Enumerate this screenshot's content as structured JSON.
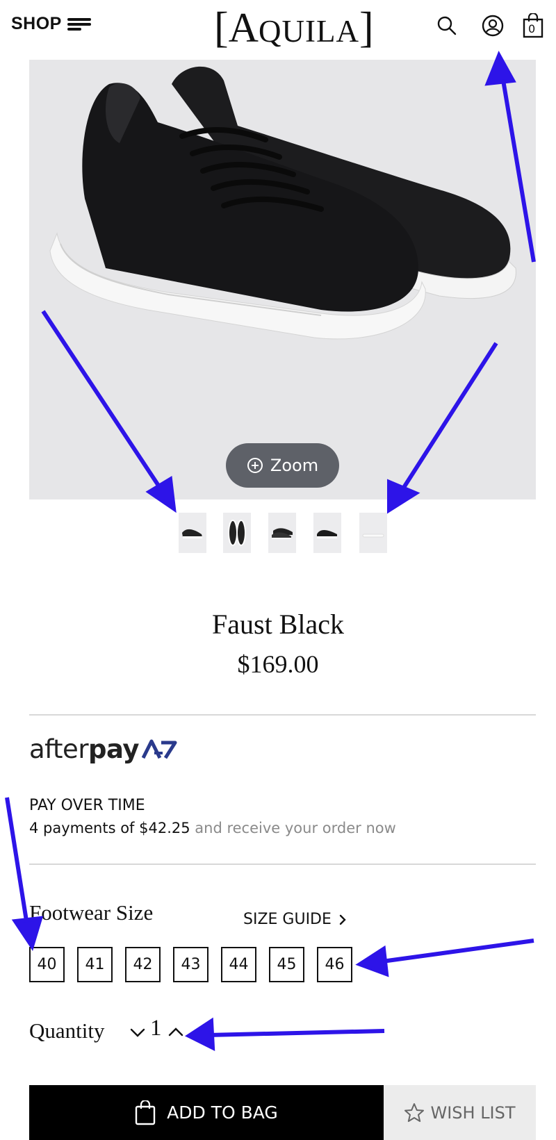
{
  "header": {
    "shop_label": "SHOP",
    "logo": {
      "open": "[",
      "a": "A",
      "rest": "QUILA",
      "close": "]"
    },
    "icons": [
      "menu-icon",
      "search-icon",
      "account-icon",
      "bag-icon"
    ],
    "bag_count": "0"
  },
  "product": {
    "name": "Faust Black",
    "price": "$169.00",
    "zoom_label": "Zoom",
    "thumbnails": [
      "thumbnail-1",
      "thumbnail-2",
      "thumbnail-3",
      "thumbnail-4",
      "thumbnail-5"
    ]
  },
  "afterpay": {
    "logo_light": "after",
    "logo_bold": "pay",
    "title": "PAY OVER TIME",
    "payments_text": "4 payments of $42.25",
    "receive_text": " and receive your order now",
    "brand_color": "#2a3a8c"
  },
  "size": {
    "label": "Footwear Size",
    "guide_label": "SIZE GUIDE",
    "options": [
      "40",
      "41",
      "42",
      "43",
      "44",
      "45",
      "46"
    ]
  },
  "quantity": {
    "label": "Quantity",
    "value": "1"
  },
  "actions": {
    "add_to_bag": "ADD TO BAG",
    "wish_list": "WISH LIST"
  },
  "annotation_color": "#2d14e8"
}
